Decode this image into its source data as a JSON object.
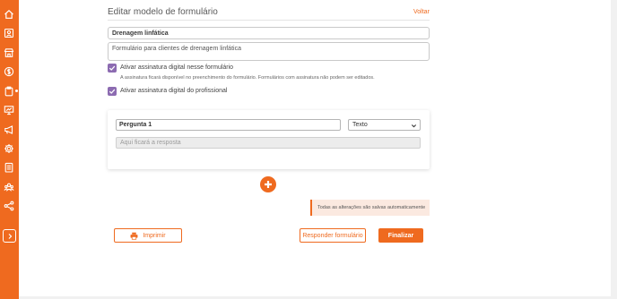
{
  "page": {
    "title": "Editar modelo de formulário",
    "back_label": "Voltar"
  },
  "form": {
    "name": "Drenagem linfática",
    "description": "Formulário para clientes de drenagem linfática"
  },
  "options": {
    "digital_signature_label": "Ativar assinatura digital nesse formulário",
    "digital_signature_checked": true,
    "digital_signature_hint": "A assinatura ficará disponível no preenchimento do formulário. Formulários com assinatura não podem ser editados.",
    "professional_signature_label": "Ativar assinatura digital do profissional",
    "professional_signature_checked": true
  },
  "question": {
    "title": "Pergunta 1",
    "type": "Texto",
    "answer_placeholder": "Aqui ficará a resposta"
  },
  "autosave_notice": "Todas as alterações são salvas automaticamente",
  "actions": {
    "print_label": "Imprimir",
    "respond_label": "Responder formulário",
    "finish_label": "Finalizar"
  },
  "sidebar": {
    "items": [
      {
        "icon": "home-icon"
      },
      {
        "icon": "clients-icon"
      },
      {
        "icon": "store-icon"
      },
      {
        "icon": "finance-icon"
      },
      {
        "icon": "clipboard-icon"
      },
      {
        "icon": "presentation-icon"
      },
      {
        "icon": "megaphone-icon"
      },
      {
        "icon": "settings-icon"
      },
      {
        "icon": "forms-icon"
      },
      {
        "icon": "team-icon"
      },
      {
        "icon": "share-icon"
      }
    ]
  },
  "colors": {
    "brand": "#ef6a1f",
    "checkbox": "#8c6bb1",
    "notice_bg": "#fbe9e0"
  }
}
